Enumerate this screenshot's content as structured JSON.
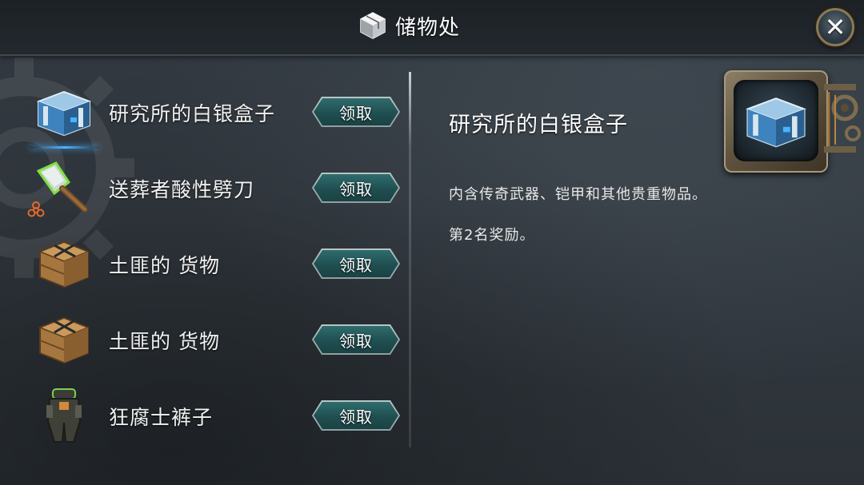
{
  "header": {
    "title": "储物处",
    "title_icon": "storage-cube-icon",
    "close_icon": "close-icon"
  },
  "items": [
    {
      "name": "研究所的白银盒子",
      "icon": "silver-box-icon",
      "button_label": "领取",
      "selected": true
    },
    {
      "name": "送葬者酸性劈刀",
      "icon": "acid-cleaver-icon",
      "button_label": "领取",
      "badge": "biohazard-icon"
    },
    {
      "name": "土匪的 货物",
      "icon": "wooden-crate-icon",
      "button_label": "领取"
    },
    {
      "name": "土匪的 货物",
      "icon": "wooden-crate-icon",
      "button_label": "领取"
    },
    {
      "name": "狂腐士裤子",
      "icon": "armor-pants-icon",
      "button_label": "领取"
    }
  ],
  "detail": {
    "title": "研究所的白银盒子",
    "description": "内含传奇武器、铠甲和其他贵重物品。",
    "rank_text": "第2名奖励。",
    "preview_icon": "silver-box-icon"
  },
  "colors": {
    "button_fill": "#204f51",
    "button_border": "#b9c7c7",
    "selected_glow": "#3ea6ff",
    "frame_brass": "#8e8068"
  }
}
